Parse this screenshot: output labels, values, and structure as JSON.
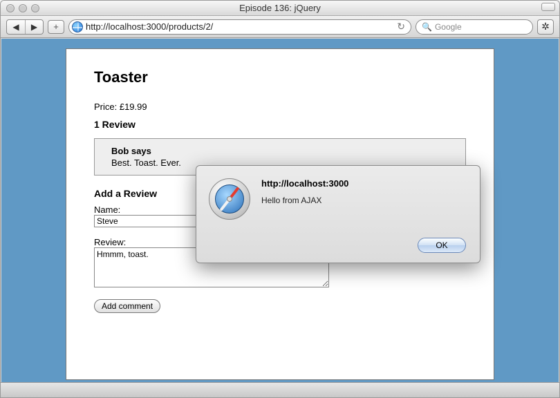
{
  "window": {
    "title": "Episode 136: jQuery"
  },
  "toolbar": {
    "url": "http://localhost:3000/products/2/",
    "search_placeholder": "Google"
  },
  "page": {
    "title": "Toaster",
    "price_label": "Price: £19.99",
    "reviews_heading": "1 Review",
    "review": {
      "author": "Bob says",
      "body": "Best. Toast. Ever."
    },
    "add_heading": "Add a Review",
    "name_label": "Name:",
    "name_value": "Steve",
    "review_label": "Review:",
    "review_value": "Hmmm, toast.",
    "submit_label": "Add comment"
  },
  "alert": {
    "title": "http://localhost:3000",
    "message": "Hello from AJAX",
    "ok": "OK"
  }
}
